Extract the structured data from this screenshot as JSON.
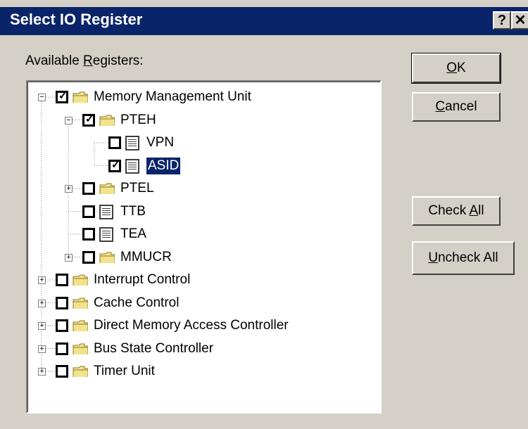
{
  "window": {
    "title": "Select IO Register",
    "help_glyph": "?",
    "close_glyph": "✕"
  },
  "available_label_pre": "Available ",
  "available_label_accel": "R",
  "available_label_post": "egisters:",
  "buttons": {
    "ok": {
      "accel": "O",
      "rest": "K"
    },
    "cancel": {
      "accel": "C",
      "rest": "ancel"
    },
    "check_all": {
      "pre": "Check ",
      "accel": "A",
      "rest": "ll"
    },
    "uncheck_all": {
      "accel": "U",
      "rest": "ncheck All"
    }
  },
  "tree": [
    {
      "label": "Memory Management Unit",
      "checked": true,
      "icon": "folder",
      "expander": "minus",
      "level": 0
    },
    {
      "label": "PTEH",
      "checked": true,
      "icon": "folder",
      "expander": "minus",
      "level": 1
    },
    {
      "label": "VPN",
      "checked": false,
      "icon": "register",
      "expander": "none",
      "level": 2
    },
    {
      "label": "ASID",
      "checked": true,
      "icon": "register",
      "expander": "none",
      "level": 2,
      "selected": true
    },
    {
      "label": "PTEL",
      "checked": false,
      "icon": "folder",
      "expander": "plus",
      "level": 1
    },
    {
      "label": "TTB",
      "checked": false,
      "icon": "register",
      "expander": "none",
      "level": 1
    },
    {
      "label": "TEA",
      "checked": false,
      "icon": "register",
      "expander": "none",
      "level": 1
    },
    {
      "label": "MMUCR",
      "checked": false,
      "icon": "folder",
      "expander": "plus",
      "level": 1
    },
    {
      "label": "Interrupt Control",
      "checked": false,
      "icon": "folder",
      "expander": "plus",
      "level": 0
    },
    {
      "label": "Cache Control",
      "checked": false,
      "icon": "folder",
      "expander": "plus",
      "level": 0
    },
    {
      "label": "Direct Memory Access Controller",
      "checked": false,
      "icon": "folder",
      "expander": "plus",
      "level": 0
    },
    {
      "label": "Bus State Controller",
      "checked": false,
      "icon": "folder",
      "expander": "plus",
      "level": 0
    },
    {
      "label": "Timer Unit",
      "checked": false,
      "icon": "folder",
      "expander": "plus",
      "level": 0
    }
  ],
  "colors": {
    "titlebar": "#0a246a",
    "face": "#d4d0c8",
    "folder": "#f2e28c",
    "selection": "#0a246a"
  }
}
